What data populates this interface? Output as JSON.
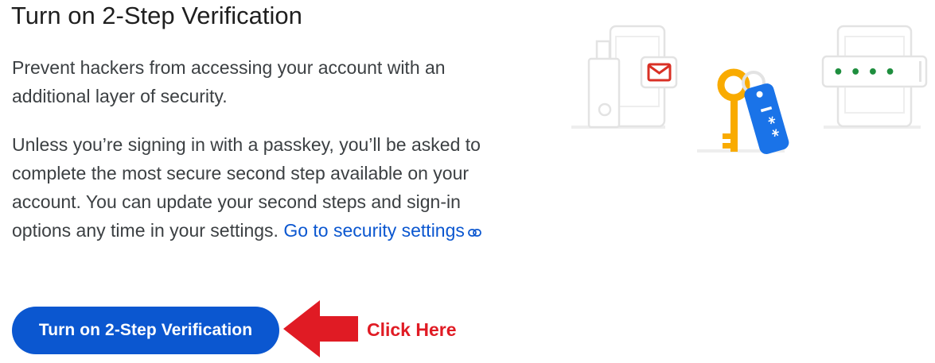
{
  "header": {
    "title": "Turn on 2-Step Verification"
  },
  "description": {
    "intro": "Prevent hackers from accessing your account with an additional layer of security.",
    "details": "Unless you’re signing in with a passkey, you’ll be asked to complete the most secure second step available on your account. You can update your second steps and sign-in options any time in your settings.",
    "security_link_label": "Go to security settings"
  },
  "actions": {
    "primary_button_label": "Turn on 2-Step Verification"
  },
  "annotation": {
    "label": "Click Here",
    "color": "#e01b24"
  },
  "icons": {
    "link": "link-icon",
    "illustration": [
      "phone-icon",
      "usb-key-icon",
      "mail-icon",
      "key-icon",
      "password-tag-icon",
      "password-prompt-icon"
    ]
  },
  "illustration": {
    "tag_text": "I * *",
    "prompt_dots": "• • • •"
  },
  "colors": {
    "accent": "#0b57d0",
    "key": "#f9ab00",
    "tag": "#1a73e8",
    "mail": "#d93025",
    "dots": "#1e8e3e"
  }
}
